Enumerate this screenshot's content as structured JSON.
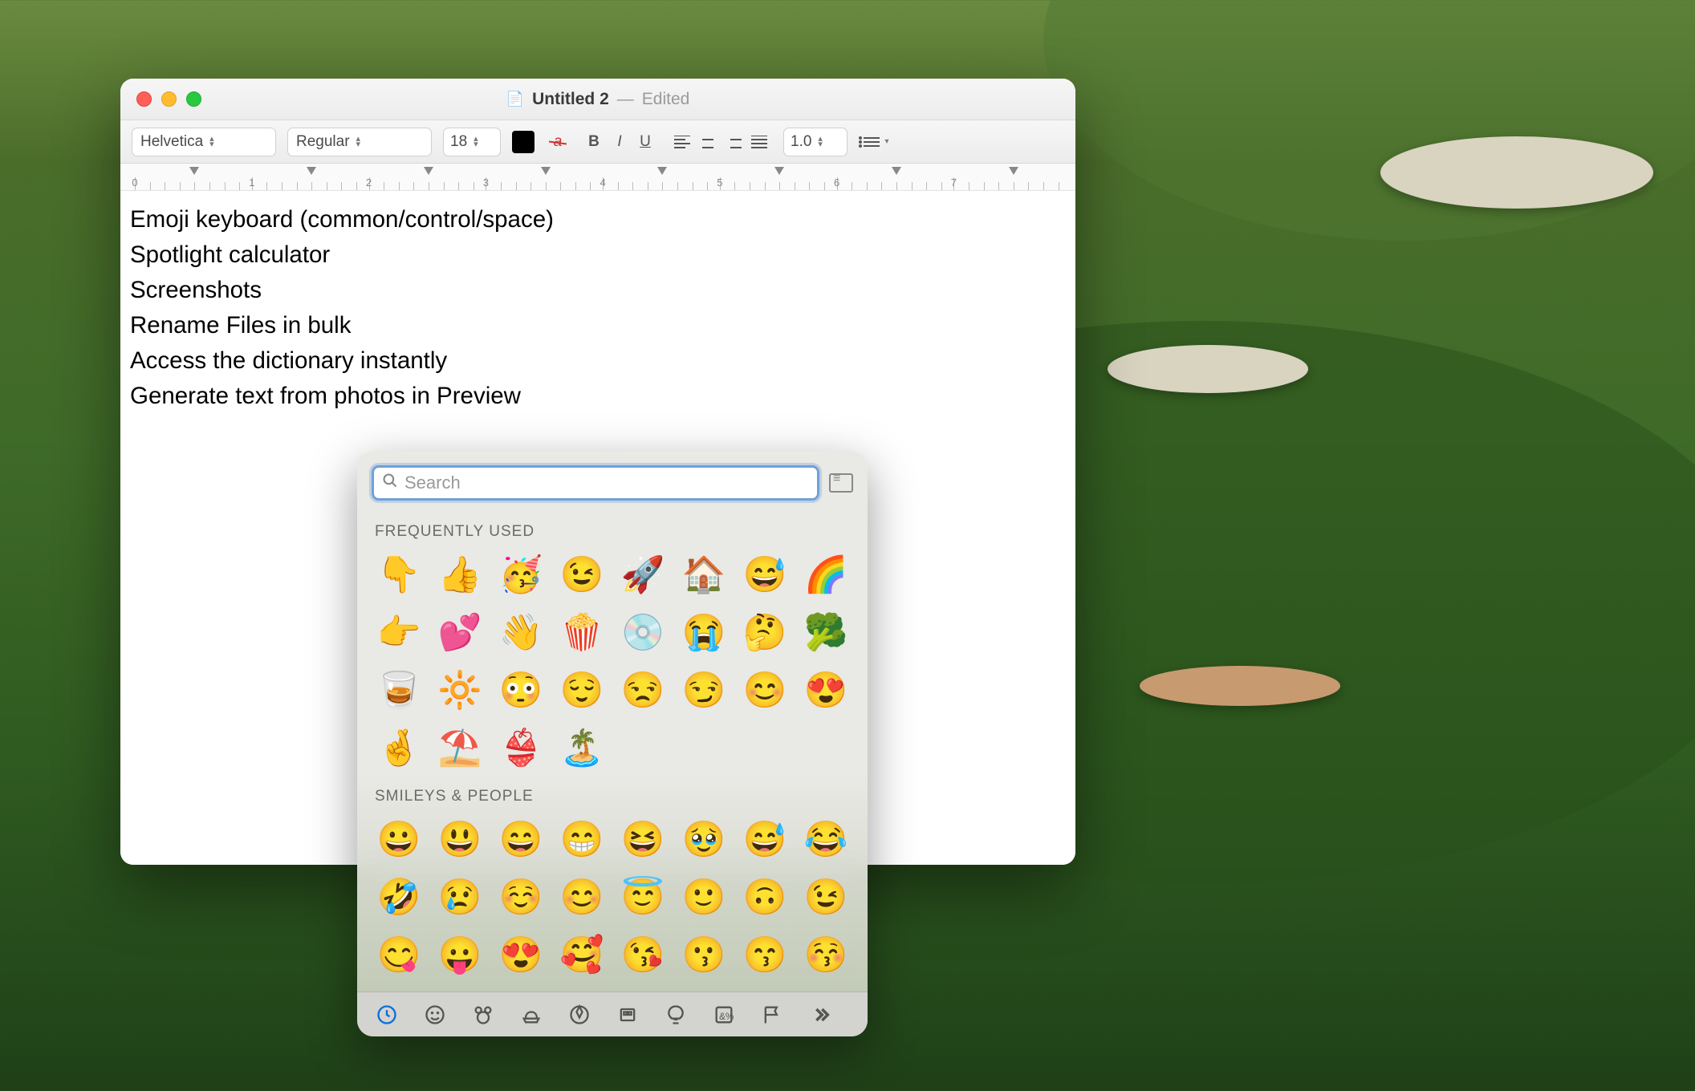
{
  "window": {
    "title": "Untitled 2",
    "status": "Edited"
  },
  "toolbar": {
    "font_family": "Helvetica",
    "font_style": "Regular",
    "font_size": "18",
    "line_spacing": "1.0",
    "bold": "B",
    "italic": "I",
    "underline": "U"
  },
  "ruler": {
    "labels": [
      "0",
      "1",
      "2",
      "3",
      "4",
      "5",
      "6",
      "7"
    ]
  },
  "document": {
    "lines": [
      "Emoji keyboard (common/control/space)",
      "Spotlight calculator",
      "Screenshots",
      "Rename Files in bulk",
      "Access the dictionary instantly",
      "Generate text from photos in Preview"
    ]
  },
  "emoji_picker": {
    "search_placeholder": "Search",
    "sections": {
      "frequent_title": "FREQUENTLY USED",
      "frequent": [
        "👇",
        "👍",
        "🥳",
        "😉",
        "🚀",
        "🏠",
        "😅",
        "🌈",
        "👉",
        "💕",
        "👋",
        "🍿",
        "💿",
        "😭",
        "🤔",
        "🥦",
        "🥃",
        "🔆",
        "😳",
        "😌",
        "😒",
        "😏",
        "😊",
        "😍",
        "🤞",
        "⛱️",
        "👙",
        "🏝️"
      ],
      "smileys_title": "SMILEYS & PEOPLE",
      "smileys": [
        "😀",
        "😃",
        "😄",
        "😁",
        "😆",
        "🥹",
        "😅",
        "😂",
        "🤣",
        "😢",
        "☺️",
        "😊",
        "😇",
        "🙂",
        "🙃",
        "😉",
        "😋",
        "😛",
        "😍",
        "🥰",
        "😘",
        "😗",
        "😙",
        "😚"
      ]
    },
    "tabs": [
      "clock",
      "smiley",
      "animal",
      "food",
      "sport",
      "travel",
      "lightbulb",
      "symbols",
      "flag",
      "more"
    ]
  }
}
